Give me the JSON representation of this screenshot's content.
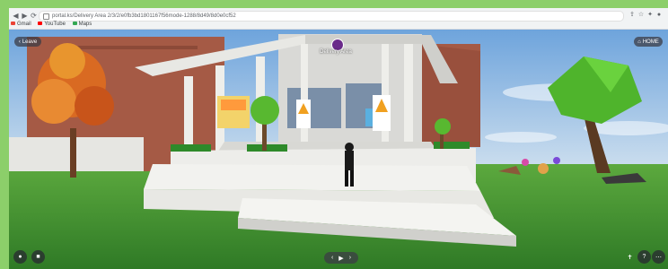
{
  "browser": {
    "url": "portal.ks/Delivery Area 2/3/2/e0fb3bd1801167f56mode-1288/8d49/8d0e0cf52",
    "bookmarks": [
      {
        "label": "Gmail",
        "color": "#ea4335"
      },
      {
        "label": "YouTube",
        "color": "#ff0000"
      },
      {
        "label": "Maps",
        "color": "#34a853"
      }
    ]
  },
  "overlay": {
    "leave_label": "Leave",
    "home_label": "HOME",
    "venue_name": "Delivery Area"
  },
  "bottom_controls": {
    "left": [
      "mic-icon",
      "camera-icon"
    ],
    "center": [
      "prev-icon",
      "play-icon",
      "next-icon"
    ],
    "right": [
      "figure-icon",
      "help-icon",
      "more-icon"
    ]
  }
}
